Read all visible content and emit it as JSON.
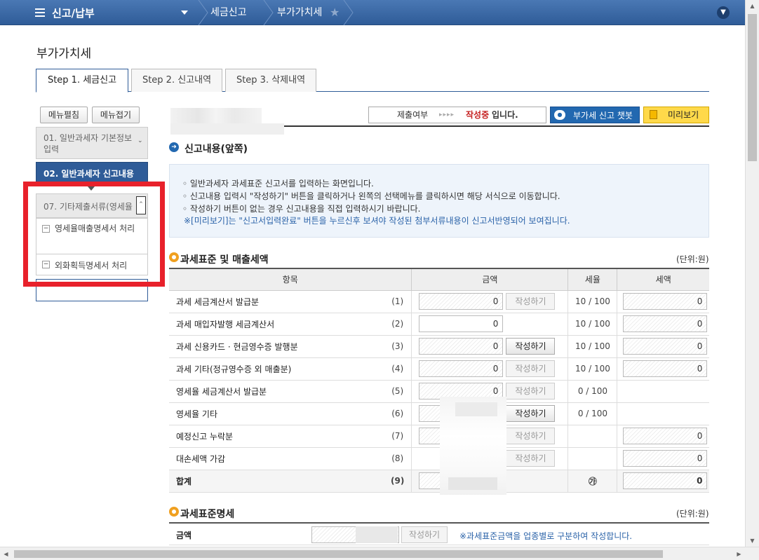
{
  "topbar": {
    "menu_label": "신고/납부",
    "crumbs": [
      "세금신고",
      "부가가치세"
    ]
  },
  "page": {
    "title": "부가가치세"
  },
  "tabs": [
    {
      "label": "Step 1. 세금신고",
      "active": true
    },
    {
      "label": "Step 2. 신고내역",
      "active": false
    },
    {
      "label": "Step 3. 삭제내역",
      "active": false
    }
  ],
  "sidebar": {
    "expand_label": "메뉴펼침",
    "collapse_label": "메뉴접기",
    "items": [
      {
        "label": "01. 일반과세자 기본정보 입력"
      },
      {
        "label": "02. 일반과세자 신고내용"
      },
      {
        "label": "07. 기타제출서류(영세율"
      }
    ],
    "sub_items": [
      {
        "label": "영세율매출명세서 처리"
      },
      {
        "label": "외화획득명세서 처리"
      }
    ]
  },
  "status": {
    "label": "제출여부",
    "arrows": "▸▸▸▸",
    "state": "작성중",
    "suffix": "입니다."
  },
  "buttons": {
    "chatbot": "부가세 신고 챗봇",
    "preview": "미리보기"
  },
  "section1": {
    "title": "신고내용(앞쪽)",
    "info": [
      "◦ 일반과세자 과세표준 신고서를 입력하는 화면입니다.",
      "◦ 신고내용 입력시 \"작성하기\" 버튼을 클릭하거나 왼쪽의 선택메뉴를 클릭하시면 해당 서식으로 이동합니다.",
      "◦ 작성하기 버튼이 없는 경우 신고내용을 직접 입력하시기 바랍니다.",
      "※[미리보기]는 \"신고서입력완료\" 버튼을 누르신후 보셔야 작성된 첨부서류내용이 신고서반영되어 보여집니다."
    ]
  },
  "section2": {
    "title": "과세표준 및 매출세액",
    "unit": "(단위:원)",
    "headers": [
      "항목",
      "금액",
      "세율",
      "세액"
    ],
    "rows": [
      {
        "label": "과세 세금계산서 발급분",
        "num": "(1)",
        "amount": "0",
        "button": "작성하기",
        "btn_on": false,
        "rate": "10 / 100",
        "tax": "0"
      },
      {
        "label": "과세 매입자발행 세금계산서",
        "num": "(2)",
        "amount": "0",
        "button": "",
        "btn_on": false,
        "rate": "10 / 100",
        "tax": "0"
      },
      {
        "label": "과세 신용카드 · 현금영수증 발행분",
        "num": "(3)",
        "amount": "0",
        "button": "작성하기",
        "btn_on": true,
        "rate": "10 / 100",
        "tax": "0"
      },
      {
        "label": "과세 기타(정규영수증 외 매출분)",
        "num": "(4)",
        "amount": "0",
        "button": "작성하기",
        "btn_on": false,
        "rate": "10 / 100",
        "tax": "0"
      },
      {
        "label": "영세율 세금계산서 발급분",
        "num": "(5)",
        "amount": "0",
        "button": "작성하기",
        "btn_on": false,
        "rate": "0 / 100",
        "tax": ""
      },
      {
        "label": "영세율 기타",
        "num": "(6)",
        "amount": "",
        "button": "작성하기",
        "btn_on": true,
        "rate": "0 / 100",
        "tax": ""
      },
      {
        "label": "예정신고 누락분",
        "num": "(7)",
        "amount": "",
        "button": "작성하기",
        "btn_on": false,
        "rate": "",
        "tax": "0"
      },
      {
        "label": "대손세액 가감",
        "num": "(8)",
        "amount": "",
        "button": "작성하기",
        "btn_on": false,
        "rate": "",
        "tax": "0"
      },
      {
        "label": "합계",
        "num": "(9)",
        "amount": "",
        "button": "",
        "btn_on": false,
        "rate": "㉮",
        "tax": "0"
      }
    ]
  },
  "section3": {
    "title": "과세표준명세",
    "unit": "(단위:원)",
    "row_label": "금액",
    "button": "작성하기",
    "note": "※과세표준금액을 업종별로 구분하여 작성합니다."
  }
}
